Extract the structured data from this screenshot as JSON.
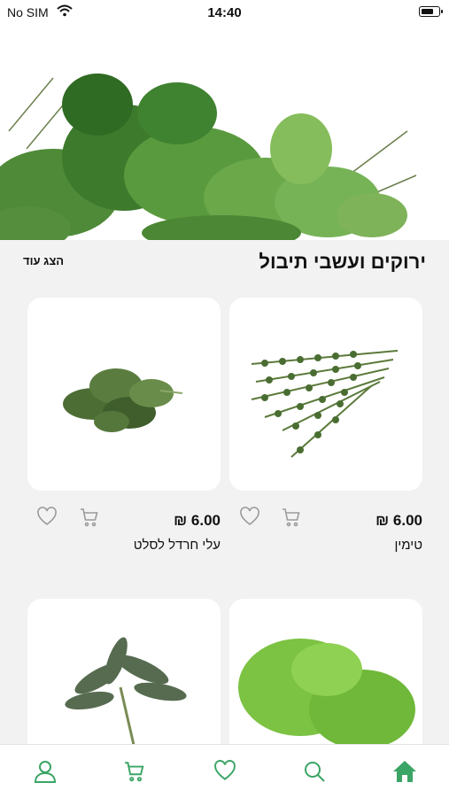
{
  "status_bar": {
    "carrier": "No SIM",
    "time": "14:40",
    "battery_level": 0.6
  },
  "section": {
    "title": "ירוקים ועשבי תיבול",
    "show_more": "הצג עוד"
  },
  "products": [
    {
      "name": "טימין",
      "price": "6.00 ₪"
    },
    {
      "name": "עלי חרדל לסלט",
      "price": "6.00 ₪"
    }
  ],
  "tabbar": {
    "items": [
      "home-icon",
      "search-icon",
      "heart-icon",
      "cart-icon",
      "user-icon"
    ],
    "active": "home-icon",
    "accent_color": "#3aa565"
  }
}
